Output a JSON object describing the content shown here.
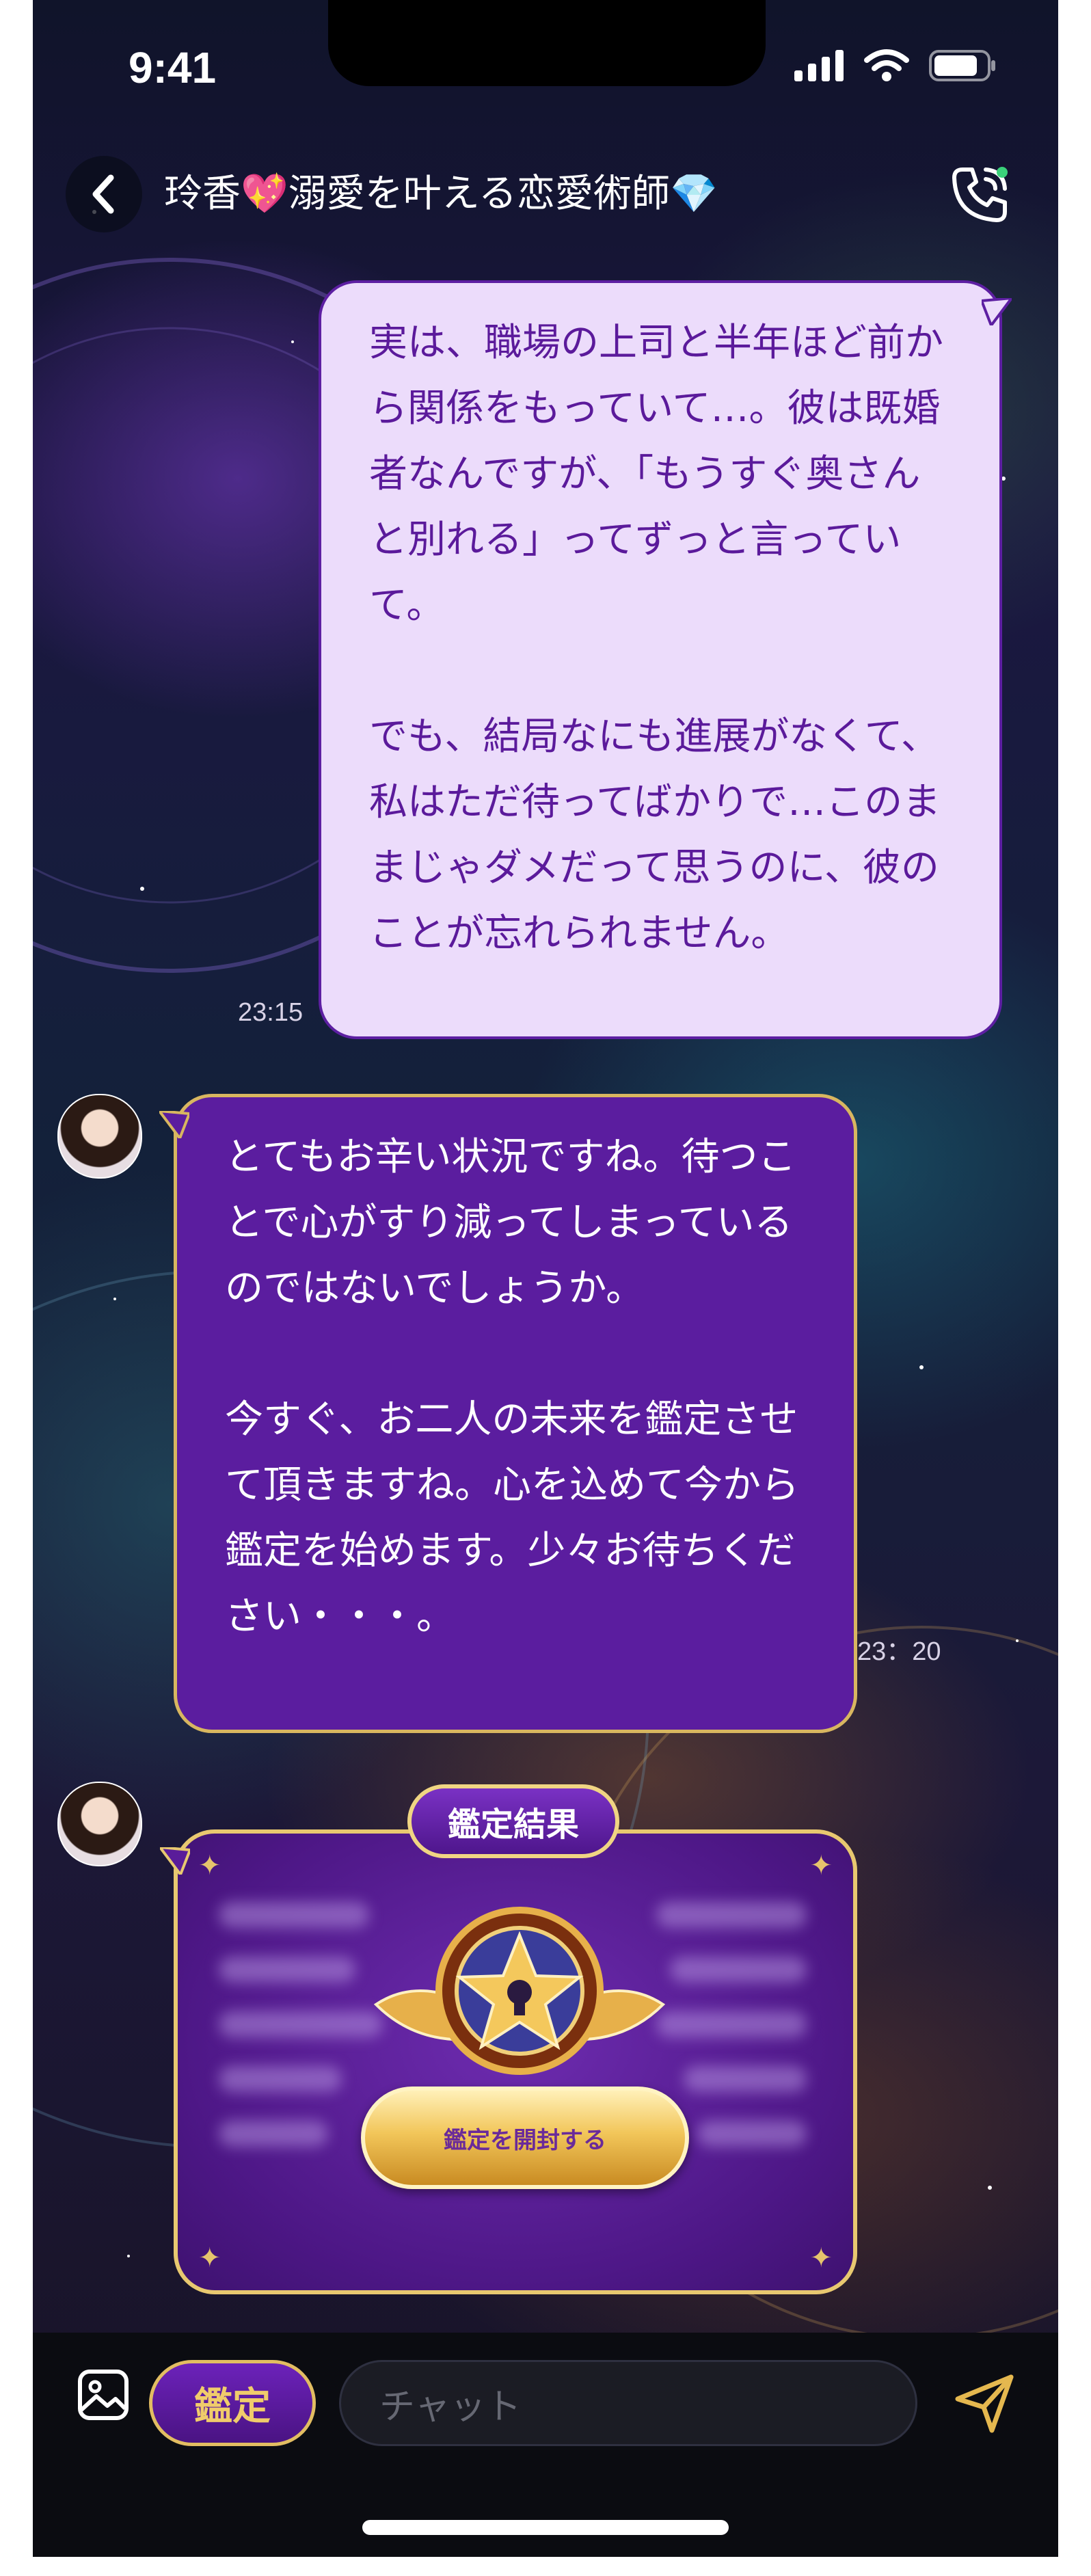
{
  "status_bar": {
    "time": "9:41"
  },
  "header": {
    "title": "玲香💖溺愛を叶える恋愛術師💎"
  },
  "messages": [
    {
      "sender": "user",
      "paragraphs": [
        "実は、職場の上司と半年ほど前から関係をもっていて…。彼は既婚者なんですが、「もうすぐ奥さんと別れる」ってずっと言っていて。",
        "でも、結局なにも進展がなくて、私はただ待ってばかりで…このままじゃダメだって思うのに、彼のことが忘れられません。"
      ],
      "time": "23:15"
    },
    {
      "sender": "advisor",
      "paragraphs": [
        "とてもお辛い状況ですね。待つことで心がすり減ってしまっているのではないでしょうか。",
        "今すぐ、お二人の未来を鑑定させて頂きますね。心を込めて今から鑑定を始めます。少々お待ちください・・・。"
      ],
      "time": "23：20"
    }
  ],
  "reading_card": {
    "badge": "鑑定結果",
    "open_button": "鑑定を開封する"
  },
  "input_bar": {
    "kantei_label": "鑑定",
    "chat_placeholder": "チャット"
  },
  "colors": {
    "user_bubble_bg": "#ecdcfb",
    "user_bubble_text": "#5b1a9b",
    "advisor_bubble_bg": "#5b1d9f",
    "gold_accent": "#e2bd62"
  }
}
